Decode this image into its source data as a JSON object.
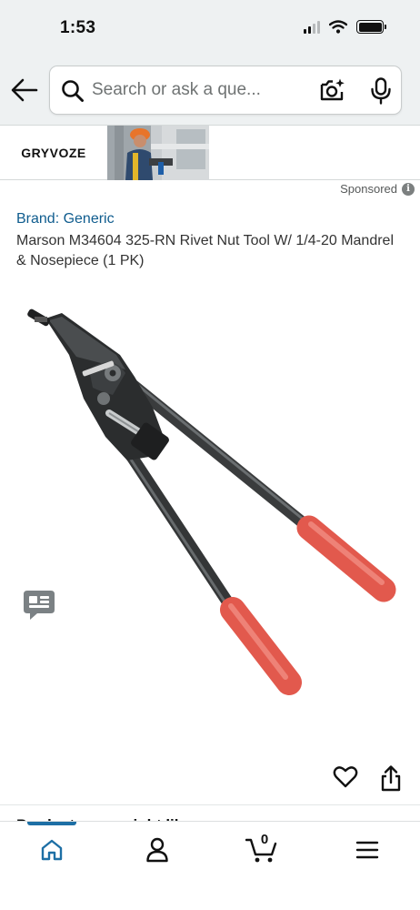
{
  "status_bar": {
    "time": "1:53"
  },
  "search": {
    "placeholder": "Search or ask a que..."
  },
  "ad": {
    "brand_name": "GRYVOZE",
    "sponsored_label": "Sponsored",
    "info_glyph": "i"
  },
  "product": {
    "brand_link": "Brand: Generic",
    "title": "Marson M34604 325-RN Rivet Nut Tool W/ 1/4-20 Mandrel & Nosepiece (1 PK)"
  },
  "next_section": {
    "heading": "Products you might like"
  },
  "bottom_nav": {
    "cart_count": "0",
    "items": [
      "home-icon",
      "account-icon",
      "cart-icon",
      "menu-icon"
    ]
  },
  "icons": [
    "back-arrow-icon",
    "search-icon",
    "camera-icon",
    "microphone-icon",
    "info-icon",
    "chat-icon",
    "heart-icon",
    "share-icon"
  ],
  "colors": {
    "header_bg": "#eef1f2",
    "link": "#0f5c8e",
    "nav_active": "#1d6fa5",
    "handle_grip": "#e2594d"
  }
}
